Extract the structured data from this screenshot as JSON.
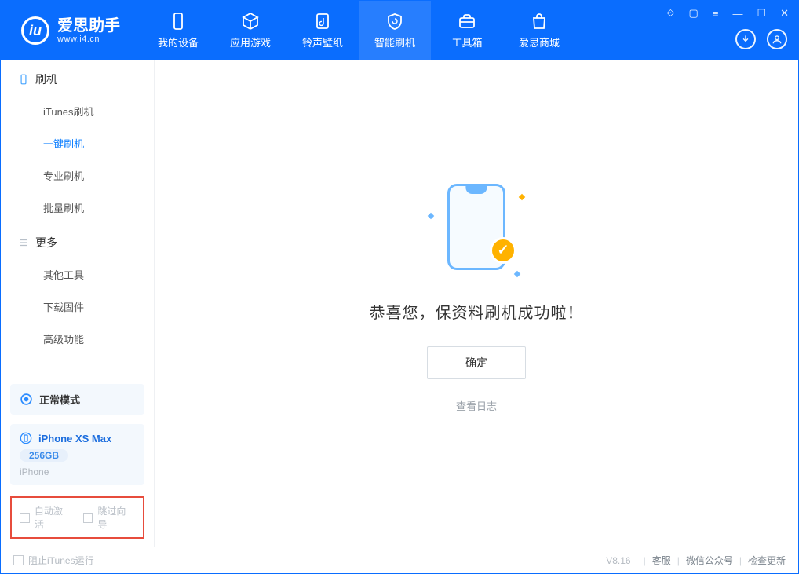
{
  "app": {
    "name": "爱思助手",
    "url": "www.i4.cn"
  },
  "nav": {
    "items": [
      {
        "label": "我的设备"
      },
      {
        "label": "应用游戏"
      },
      {
        "label": "铃声壁纸"
      },
      {
        "label": "智能刷机"
      },
      {
        "label": "工具箱"
      },
      {
        "label": "爱思商城"
      }
    ]
  },
  "sidebar": {
    "group1_title": "刷机",
    "group1_items": [
      {
        "label": "iTunes刷机"
      },
      {
        "label": "一键刷机"
      },
      {
        "label": "专业刷机"
      },
      {
        "label": "批量刷机"
      }
    ],
    "group2_title": "更多",
    "group2_items": [
      {
        "label": "其他工具"
      },
      {
        "label": "下载固件"
      },
      {
        "label": "高级功能"
      }
    ],
    "mode_label": "正常模式",
    "device": {
      "name": "iPhone XS Max",
      "storage": "256GB",
      "type": "iPhone"
    },
    "auto_activate": "自动激活",
    "skip_guide": "跳过向导"
  },
  "main": {
    "headline": "恭喜您，保资料刷机成功啦！",
    "ok": "确定",
    "view_log": "查看日志"
  },
  "footer": {
    "block_itunes": "阻止iTunes运行",
    "version": "V8.16",
    "links": {
      "service": "客服",
      "wechat": "微信公众号",
      "update": "检查更新"
    }
  }
}
